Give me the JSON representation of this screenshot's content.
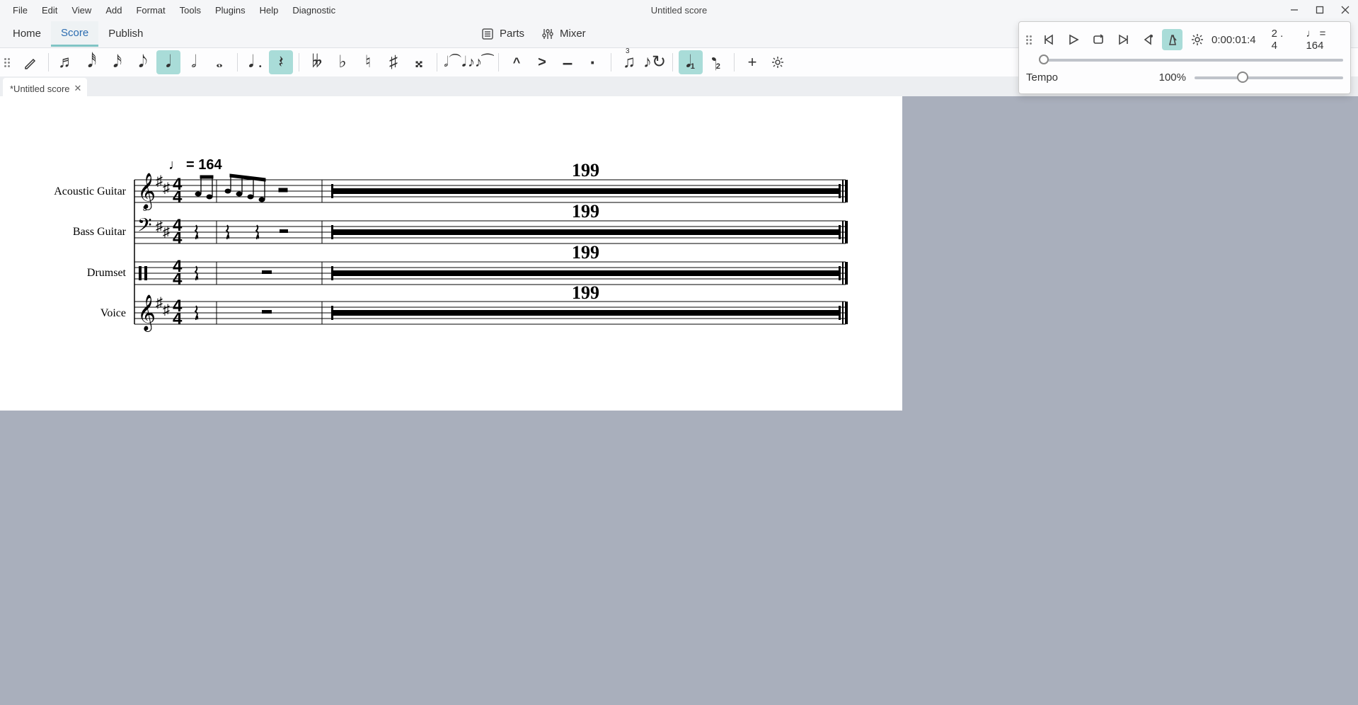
{
  "window": {
    "title": "Untitled score"
  },
  "menu": {
    "items": [
      "File",
      "Edit",
      "View",
      "Add",
      "Format",
      "Tools",
      "Plugins",
      "Help",
      "Diagnostic"
    ]
  },
  "mainTabs": {
    "items": [
      "Home",
      "Score",
      "Publish"
    ],
    "active": 1
  },
  "rightToggles": {
    "parts": "Parts",
    "mixer": "Mixer"
  },
  "docTabs": {
    "items": [
      {
        "label": "*Untitled score"
      }
    ]
  },
  "playback": {
    "time": "0:00:01:4",
    "beat": "2 . 4",
    "tempo_display": "= 164",
    "tempo_note": "♩",
    "tempo_label": "Tempo",
    "tempo_pct": "100%"
  },
  "score": {
    "tempo_text": "= 164",
    "staves": [
      {
        "label": "Acoustic Guitar",
        "mrest": "199"
      },
      {
        "label": "Bass Guitar",
        "mrest": "199"
      },
      {
        "label": "Drumset",
        "mrest": "199"
      },
      {
        "label": "Voice",
        "mrest": "199"
      }
    ]
  },
  "toolbar": {
    "noteValues": [
      "♬",
      "𝅘𝅥𝅰",
      "𝅘𝅥𝅯",
      "𝅘𝅥𝅮",
      "𝅘𝅥",
      "𝅗𝅥",
      "𝅝"
    ],
    "selectedNote": 4,
    "restSelected": true,
    "voiceSelected": 1
  }
}
